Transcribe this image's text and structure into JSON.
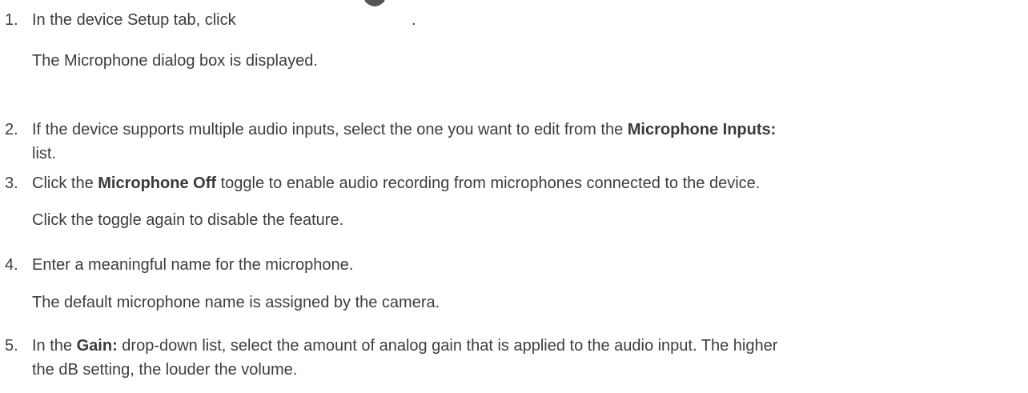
{
  "steps": [
    {
      "number": "1.",
      "pre": "In the device Setup tab, click",
      "post": ".",
      "icon": "microphone-icon",
      "note": "The Microphone dialog box is displayed."
    },
    {
      "number": "2.",
      "pre": "If the device supports multiple audio inputs, select the one you want to edit from the ",
      "bold": "Microphone Inputs:",
      "post": "list."
    },
    {
      "number": "3.",
      "pre": "Click the ",
      "bold": "Microphone Off",
      "post": " toggle to enable audio recording from microphones connected to the device.",
      "note": "Click the toggle again to disable the feature."
    },
    {
      "number": "4.",
      "pre": "Enter a meaningful name for the microphone.",
      "note": "The default microphone name is assigned by the camera."
    },
    {
      "number": "5.",
      "pre": "In the ",
      "bold": "Gain:",
      "post": " drop-down list, select the amount of analog gain that is applied to the audio input. The higher",
      "line2": "the dB setting, the louder the volume."
    }
  ]
}
